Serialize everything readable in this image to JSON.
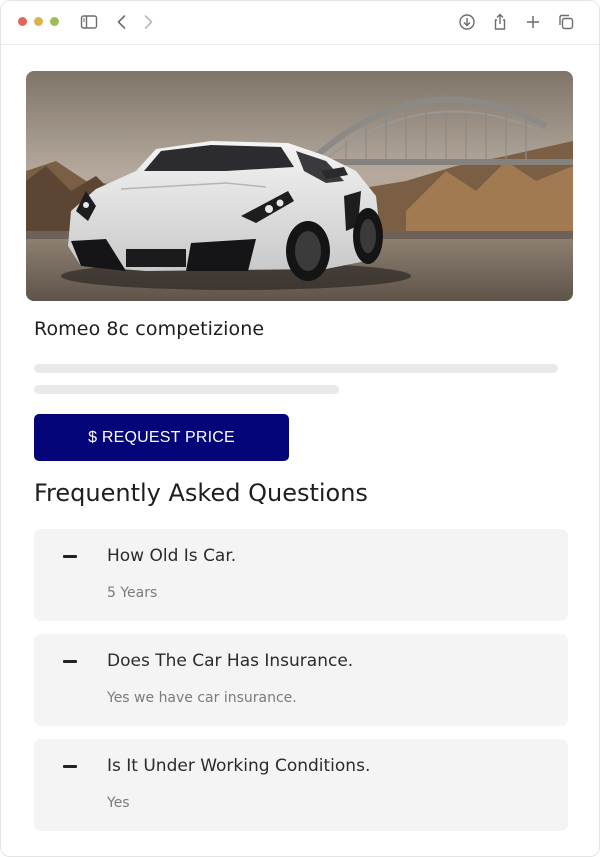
{
  "browser": {
    "icons": [
      "sidebar-icon",
      "chevron-left-icon",
      "chevron-right-icon",
      "download-icon",
      "share-icon",
      "plus-icon",
      "tabs-icon"
    ]
  },
  "product": {
    "title": "Romeo 8c competizione",
    "request_button": "$ REQUEST PRICE"
  },
  "faq": {
    "title": "Frequently Asked Questions",
    "items": [
      {
        "question": "How Old Is Car.",
        "answer": "5 Years"
      },
      {
        "question": "Does The Car Has Insurance.",
        "answer": "Yes we have car insurance."
      },
      {
        "question": "Is It Under Working Conditions.",
        "answer": "Yes"
      }
    ]
  },
  "colors": {
    "accent": "#05057a",
    "faq_background": "#f4f4f4"
  }
}
